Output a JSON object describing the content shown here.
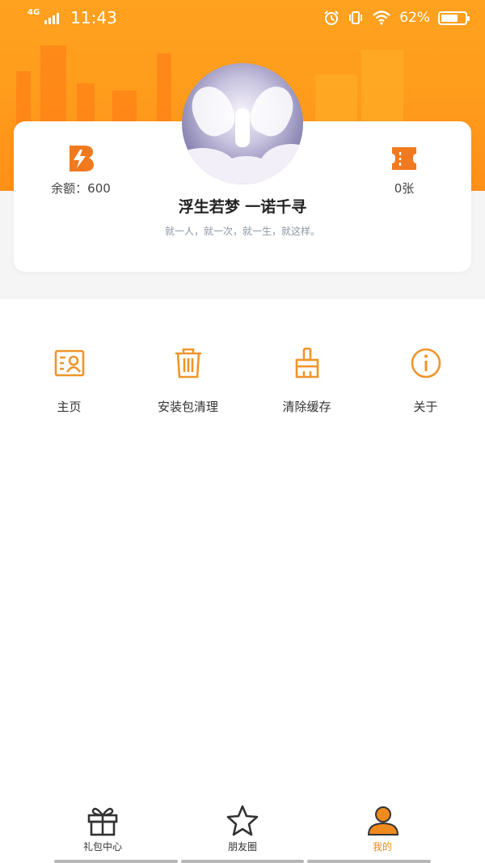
{
  "status_bar": {
    "network": "4G",
    "time": "11:43",
    "battery_percent": "62%",
    "battery_level": 0.62,
    "icons": [
      "alarm-icon",
      "vibrate-icon",
      "wifi-icon",
      "battery-icon"
    ]
  },
  "profile": {
    "username": "浮生若梦 一诺千寻",
    "motto": "就一人，就一次，就一生，就这样。",
    "balance_label": "余额：600",
    "tickets_label": "0张"
  },
  "menu": [
    {
      "label": "主页",
      "icon": "profile-card-icon"
    },
    {
      "label": "安装包清理",
      "icon": "trash-icon"
    },
    {
      "label": "清除缓存",
      "icon": "broom-icon"
    },
    {
      "label": "关于",
      "icon": "info-icon"
    }
  ],
  "bottom_nav": [
    {
      "label": "礼包中心",
      "icon": "gift-icon",
      "active": false
    },
    {
      "label": "朋友圈",
      "icon": "star-icon",
      "active": false
    },
    {
      "label": "我的",
      "icon": "user-icon",
      "active": true
    }
  ],
  "colors": {
    "accent": "#f08a1f",
    "banner": "#ff9c1c",
    "background_gray": "#f5f5f5"
  }
}
